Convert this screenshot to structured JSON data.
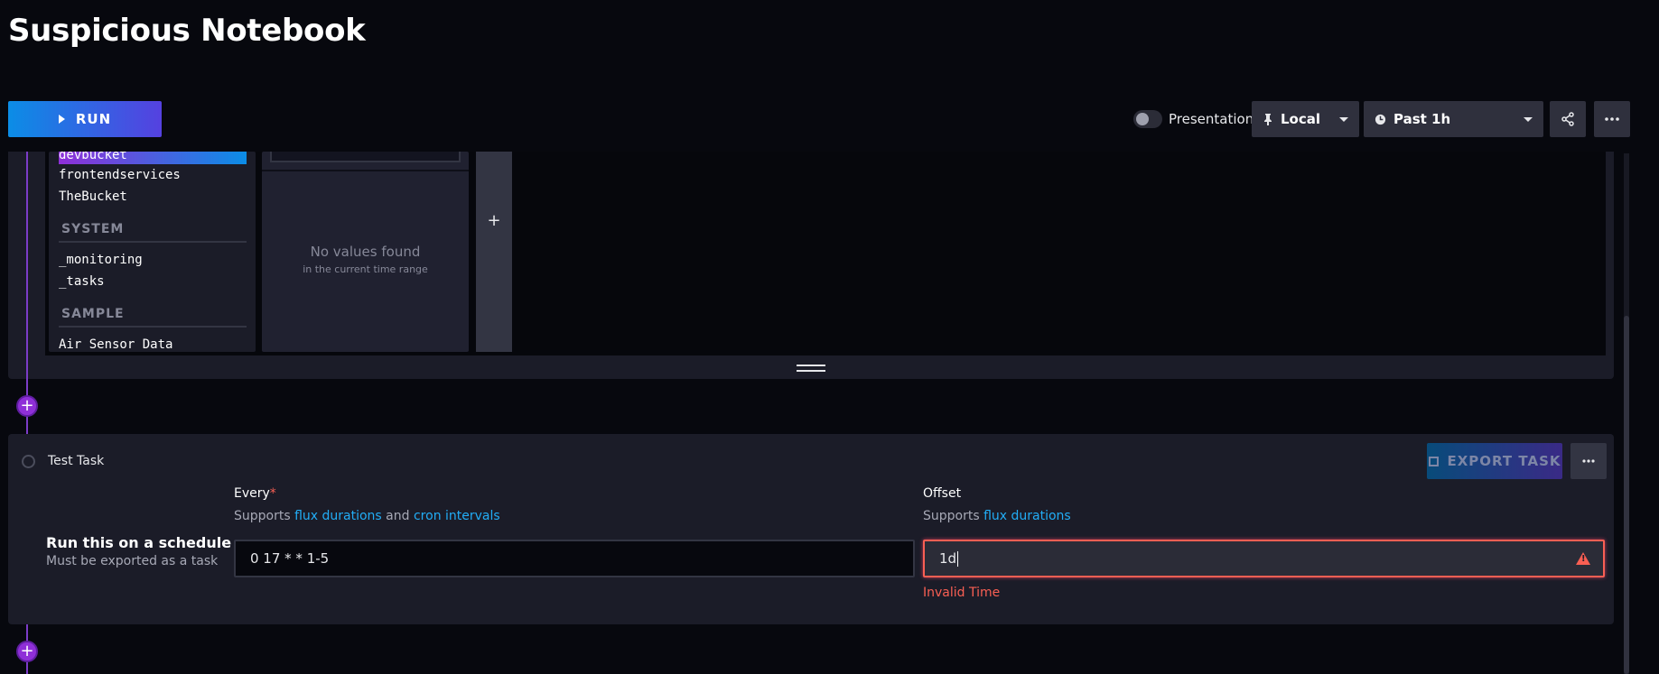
{
  "page": {
    "title": "Suspicious Notebook"
  },
  "header": {
    "run_label": "RUN",
    "presentation_label": "Presentation",
    "timezone_label": "Local",
    "time_range_label": "Past 1h",
    "share_icon": "share-icon",
    "more_icon": "more-horizontal-icon"
  },
  "query_builder": {
    "buckets": {
      "selected": "devbucket",
      "user_items": [
        "devbucket",
        "frontendservices",
        "TheBucket"
      ],
      "system_heading": "SYSTEM",
      "system_items": [
        "_monitoring",
        "_tasks"
      ],
      "sample_heading": "SAMPLE",
      "sample_items": [
        "Air Sensor Data"
      ]
    },
    "values": {
      "empty_title": "No values found",
      "empty_subtitle": "in the current time range"
    },
    "add_label": "+"
  },
  "task_panel": {
    "title": "Test Task",
    "export_label": "EXPORT TASK",
    "schedule_title": "Run this on a schedule",
    "schedule_subtitle": "Must be exported as a task",
    "every": {
      "label": "Every",
      "required_mark": "*",
      "help_prefix": "Supports ",
      "help_link1": "flux durations",
      "help_mid": " and ",
      "help_link2": "cron intervals",
      "value": "0 17 * * 1-5"
    },
    "offset": {
      "label": "Offset",
      "help_prefix": "Supports ",
      "help_link": "flux durations",
      "value": "1d",
      "error": "Invalid Time"
    }
  },
  "colors": {
    "accent_purple": "#8f2fd8",
    "accent_blue": "#0b8de6",
    "error": "#f95f53",
    "link": "#22adf6"
  }
}
